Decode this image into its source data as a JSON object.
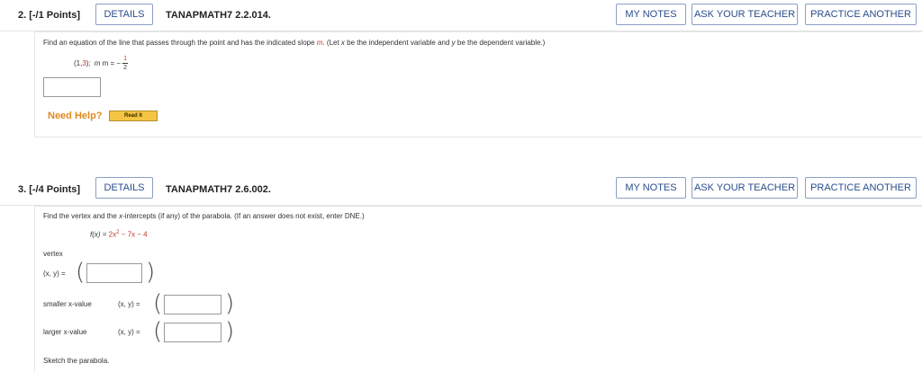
{
  "q2": {
    "number": "2. [-/1 Points]",
    "details": "DETAILS",
    "code": "TANAPMATH7 2.2.014.",
    "my_notes": "MY NOTES",
    "ask_teacher": "ASK YOUR TEACHER",
    "practice": "PRACTICE ANOTHER",
    "prompt_a": "Find an equation of the line that passes through the point and has the indicated slope ",
    "prompt_m": "m",
    "prompt_b": ". (Let ",
    "prompt_x": "x",
    "prompt_c": " be the independent variable and ",
    "prompt_y": "y",
    "prompt_d": " be the dependent variable.)",
    "point_open": "(1, ",
    "point_y": "3",
    "point_close": ");",
    "slope_label": "m = −",
    "slope_num": "1",
    "slope_den": "2",
    "answer_value": "",
    "need_help": "Need Help?",
    "read_it": "Read It"
  },
  "q3": {
    "number": "3. [-/4 Points]",
    "details": "DETAILS",
    "code": "TANAPMATH7 2.6.002.",
    "my_notes": "MY NOTES",
    "ask_teacher": "ASK YOUR TEACHER",
    "practice": "PRACTICE ANOTHER",
    "prompt_a": "Find the vertex and the ",
    "prompt_x": "x",
    "prompt_b": "-intercepts (if any) of the parabola. (If an answer does not exist, enter DNE.)",
    "f_label": "f(x) = ",
    "f_a": "2x",
    "f_exp": "2",
    "f_b": " − 7x − 4",
    "vertex_label": "vertex",
    "xy_label": "(x, y) =",
    "smaller_label": "smaller x-value",
    "larger_label": "larger x-value",
    "vertex_value": "",
    "smaller_value": "",
    "larger_value": "",
    "sketch": "Sketch the parabola."
  }
}
